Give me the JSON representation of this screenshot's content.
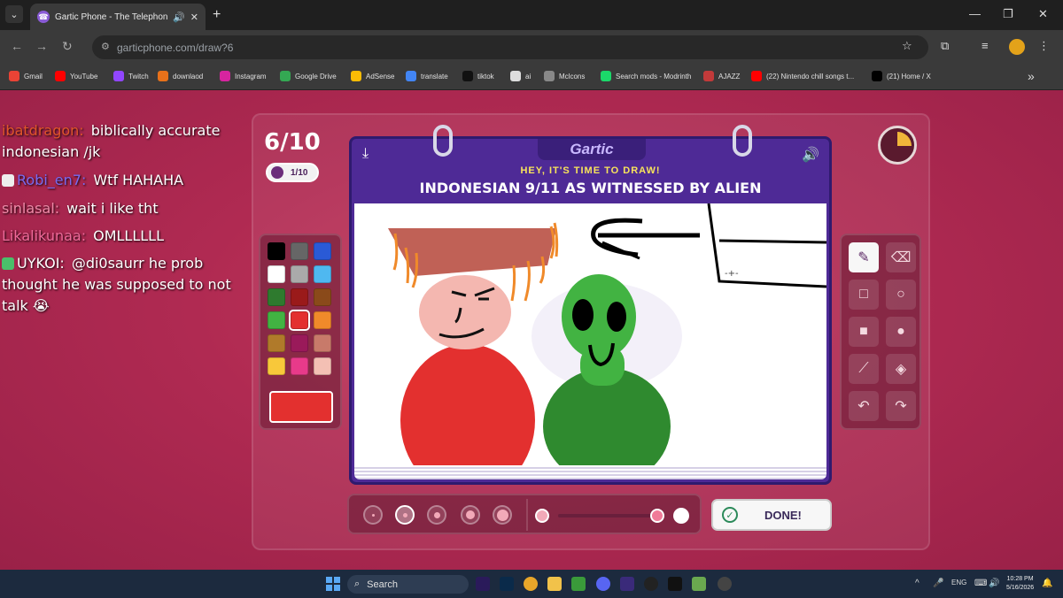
{
  "browser": {
    "tab_title": "Gartic Phone - The Telephone Game",
    "url": "garticphone.com/draw?6",
    "bookmarks": [
      {
        "label": "Gmail",
        "color": "#ea4335"
      },
      {
        "label": "YouTube",
        "color": "#ff0000"
      },
      {
        "label": "Twitch",
        "color": "#9146ff"
      },
      {
        "label": "downlaod",
        "color": "#e8711a"
      },
      {
        "label": "Instagram",
        "color": "#d6249f"
      },
      {
        "label": "Google Drive",
        "color": "#34a853"
      },
      {
        "label": "AdSense",
        "color": "#fbbc05"
      },
      {
        "label": "translate",
        "color": "#4285f4"
      },
      {
        "label": "tiktok",
        "color": "#111111"
      },
      {
        "label": "ai",
        "color": "#dddddd"
      },
      {
        "label": "Mclcons",
        "color": "#888888"
      },
      {
        "label": "Search mods - Modrinth",
        "color": "#1bd96a"
      },
      {
        "label": "AJAZZ",
        "color": "#c23a3a"
      },
      {
        "label": "(22) Nintendo chill songs t...",
        "color": "#ff0000"
      },
      {
        "label": "(21) Home / X",
        "color": "#000000"
      }
    ]
  },
  "game": {
    "round": "6/10",
    "round_pill": "1/10",
    "logo": "Gartic",
    "subtitle": "HEY, IT'S TIME TO DRAW!",
    "prompt": "INDONESIAN 9/11 AS WITNESSED BY ALIEN",
    "done_label": "DONE!",
    "timer_fraction_elapsed": 0.25,
    "selected_color": "#e3302f",
    "palette": [
      "#000000",
      "#666666",
      "#2a5ad6",
      "#ffffff",
      "#aaaaaa",
      "#4fb8f0",
      "#2e7a2e",
      "#9a1a1a",
      "#8a4a1a",
      "#42b342",
      "#e3302f",
      "#f08a2a",
      "#b07a2a",
      "#9a1a5a",
      "#c87a6a",
      "#f8c83a",
      "#e83a8a",
      "#f4c0b4"
    ],
    "tools": [
      {
        "name": "pencil-icon",
        "glyph": "✎"
      },
      {
        "name": "eraser-icon",
        "glyph": "⌫"
      },
      {
        "name": "rectangle-icon",
        "glyph": "□"
      },
      {
        "name": "ellipse-icon",
        "glyph": "○"
      },
      {
        "name": "filled-rectangle-icon",
        "glyph": "■"
      },
      {
        "name": "filled-ellipse-icon",
        "glyph": "●"
      },
      {
        "name": "line-icon",
        "glyph": "⟋"
      },
      {
        "name": "fill-bucket-icon",
        "glyph": "◈"
      },
      {
        "name": "undo-icon",
        "glyph": "↶"
      },
      {
        "name": "redo-icon",
        "glyph": "↷"
      }
    ]
  },
  "chat": [
    {
      "user": "ibatdragon:",
      "user_color": "#e0552a",
      "text": "biblically accurate"
    },
    {
      "user": "",
      "user_color": "#ffffff",
      "text": "indonesian /jk"
    },
    {
      "user": "Robi_en7:",
      "user_color": "#7a6af0",
      "text": "Wtf HAHAHA"
    },
    {
      "user": "sinlasal:",
      "user_color": "#f08aa8",
      "text": "wait i like tht"
    },
    {
      "user": "Likalikunaa:",
      "user_color": "#f06a9a",
      "text": "OMLLLLLL"
    },
    {
      "user": "UYKOI:",
      "user_color": "#ffffff",
      "text": "@di0saurr he prob"
    },
    {
      "user": "",
      "user_color": "#ffffff",
      "text": "thought he was supposed to not"
    },
    {
      "user": "",
      "user_color": "#ffffff",
      "text": "talk 😭"
    }
  ],
  "taskbar": {
    "search_placeholder": "Search",
    "lang": "ENG",
    "time": "10:28 PM",
    "date": "5/16/2026"
  }
}
